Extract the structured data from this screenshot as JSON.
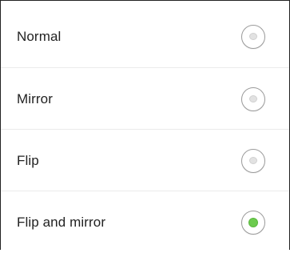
{
  "options": [
    {
      "label": "Normal",
      "selected": false
    },
    {
      "label": "Mirror",
      "selected": false
    },
    {
      "label": "Flip",
      "selected": false
    },
    {
      "label": "Flip and mirror",
      "selected": true
    }
  ],
  "colors": {
    "selected_dot": "#6ccb4e",
    "radio_border": "#9a9a9a",
    "divider": "#ebebeb",
    "text": "#222222"
  }
}
